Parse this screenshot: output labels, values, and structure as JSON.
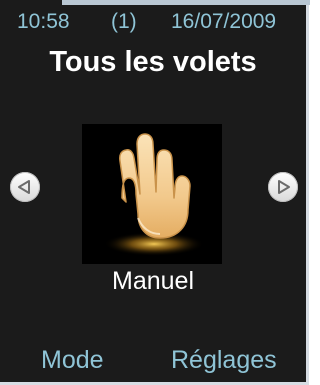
{
  "status_bar": {
    "time": "10:58",
    "count": "(1)",
    "date": "16/07/2009"
  },
  "title": "Tous les volets",
  "carousel": {
    "prev_icon": "triangle-left-icon",
    "next_icon": "triangle-right-icon",
    "current_icon": "hand-icon",
    "current_label": "Manuel"
  },
  "softkeys": {
    "left": "Mode",
    "right": "Réglages"
  },
  "colors": {
    "background": "#1b1b1b",
    "accent": "#8fc4d6",
    "text": "#ffffff"
  }
}
